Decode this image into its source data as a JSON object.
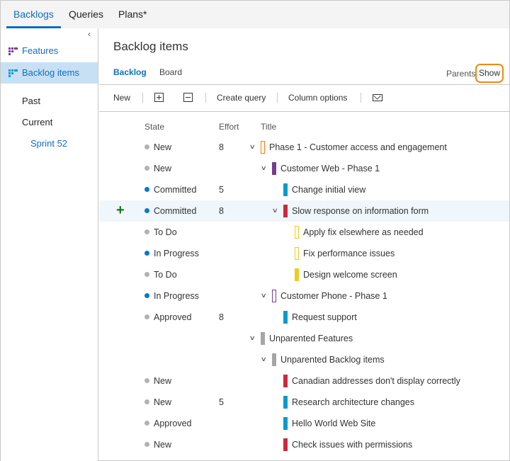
{
  "top_tabs": [
    {
      "label": "Backlogs",
      "active": true
    },
    {
      "label": "Queries",
      "active": false
    },
    {
      "label": "Plans*",
      "active": false
    }
  ],
  "sidebar": {
    "collapse_icon": "chevron-left-icon",
    "items": [
      {
        "label": "Features",
        "icon": "features-grid-icon",
        "icon_color": "#773b93",
        "selected": false
      },
      {
        "label": "Backlog items",
        "icon": "backlog-grid-icon",
        "icon_color": "#009ccc",
        "selected": true
      }
    ],
    "iterations": {
      "past": "Past",
      "current": "Current",
      "sprint": "Sprint 52"
    }
  },
  "main": {
    "title": "Backlog items",
    "pivots": [
      {
        "label": "Backlog",
        "active": true
      },
      {
        "label": "Board",
        "active": false
      }
    ],
    "parents_label": "Parents",
    "parents_value": "Show",
    "toolbar": {
      "new_label": "New",
      "expand_icon": "expand-all-icon",
      "collapse_icon": "collapse-all-icon",
      "create_query_label": "Create query",
      "column_options_label": "Column options",
      "email_icon": "email-icon"
    },
    "columns": {
      "state": "State",
      "effort": "Effort",
      "title": "Title"
    },
    "colors": {
      "state_gray": "#b2b2b2",
      "state_blue": "#007acc",
      "epic": "#ff7b00",
      "feature": "#773b93",
      "pbi": "#009ccc",
      "bug": "#cc293d",
      "task": "#f2cb1d",
      "unparented": "#a6a6a6",
      "accent": "#106ebe",
      "highlight_ring": "#f0890b"
    },
    "rows": [
      {
        "state": "New",
        "state_color": "gray",
        "effort": "8",
        "title": "Phase 1 - Customer access and engagement",
        "level": 0,
        "expandable": true,
        "type": "epic",
        "hollow": true
      },
      {
        "state": "New",
        "state_color": "gray",
        "effort": "",
        "title": "Customer Web - Phase 1",
        "level": 1,
        "expandable": true,
        "type": "feature",
        "hollow": false
      },
      {
        "state": "Committed",
        "state_color": "blue",
        "effort": "5",
        "title": "Change initial view",
        "level": 2,
        "expandable": false,
        "type": "pbi",
        "hollow": false
      },
      {
        "state": "Committed",
        "state_color": "blue",
        "effort": "8",
        "title": "Slow response on information form",
        "level": 2,
        "expandable": true,
        "type": "bug",
        "hollow": false,
        "highlight": true
      },
      {
        "state": "To Do",
        "state_color": "gray",
        "effort": "",
        "title": "Apply fix elsewhere as needed",
        "level": 3,
        "expandable": false,
        "type": "task",
        "hollow": true
      },
      {
        "state": "In Progress",
        "state_color": "blue",
        "effort": "",
        "title": "Fix performance issues",
        "level": 3,
        "expandable": false,
        "type": "task",
        "hollow": true
      },
      {
        "state": "To Do",
        "state_color": "gray",
        "effort": "",
        "title": "Design welcome screen",
        "level": 3,
        "expandable": false,
        "type": "task",
        "hollow": false
      },
      {
        "state": "In Progress",
        "state_color": "blue",
        "effort": "",
        "title": "Customer Phone - Phase 1",
        "level": 1,
        "expandable": true,
        "type": "feature",
        "hollow": true
      },
      {
        "state": "Approved",
        "state_color": "gray",
        "effort": "8",
        "title": "Request support",
        "level": 2,
        "expandable": false,
        "type": "pbi",
        "hollow": false
      },
      {
        "state": "",
        "state_color": "",
        "effort": "",
        "title": "Unparented Features",
        "level": 0,
        "expandable": true,
        "type": "unparented",
        "hollow": false
      },
      {
        "state": "",
        "state_color": "",
        "effort": "",
        "title": "Unparented Backlog items",
        "level": 1,
        "expandable": true,
        "type": "unparented",
        "hollow": false
      },
      {
        "state": "New",
        "state_color": "gray",
        "effort": "",
        "title": "Canadian addresses don't display correctly",
        "level": 2,
        "expandable": false,
        "type": "bug",
        "hollow": false
      },
      {
        "state": "New",
        "state_color": "gray",
        "effort": "5",
        "title": "Research architecture changes",
        "level": 2,
        "expandable": false,
        "type": "pbi",
        "hollow": false
      },
      {
        "state": "Approved",
        "state_color": "gray",
        "effort": "",
        "title": "Hello World Web Site",
        "level": 2,
        "expandable": false,
        "type": "pbi",
        "hollow": false
      },
      {
        "state": "New",
        "state_color": "gray",
        "effort": "",
        "title": "Check issues with permissions",
        "level": 2,
        "expandable": false,
        "type": "bug",
        "hollow": false
      }
    ]
  }
}
